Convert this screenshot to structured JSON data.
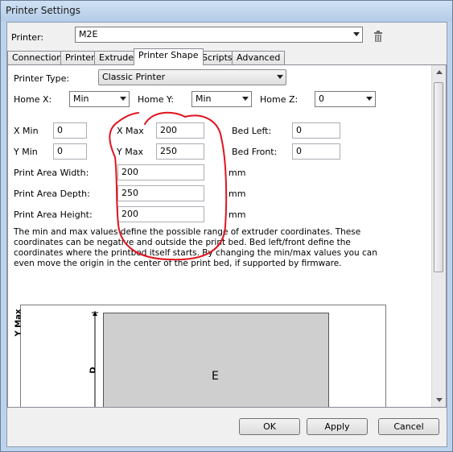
{
  "window": {
    "title": "Printer Settings"
  },
  "printer": {
    "label": "Printer:",
    "value": "M2E"
  },
  "tabs": [
    {
      "label": "Connection"
    },
    {
      "label": "Printer"
    },
    {
      "label": "Extruder"
    },
    {
      "label": "Printer Shape"
    },
    {
      "label": "Scripts"
    },
    {
      "label": "Advanced"
    }
  ],
  "active_tab": "Printer Shape",
  "shape": {
    "printer_type_label": "Printer Type:",
    "printer_type_value": "Classic Printer",
    "home_x_label": "Home X:",
    "home_x_value": "Min",
    "home_y_label": "Home Y:",
    "home_y_value": "Min",
    "home_z_label": "Home Z:",
    "home_z_value": "0",
    "x_min_label": "X Min",
    "x_min_value": "0",
    "y_min_label": "Y Min",
    "y_min_value": "0",
    "x_max_label": "X Max",
    "x_max_value": "200",
    "y_max_label": "Y Max",
    "y_max_value": "250",
    "bed_left_label": "Bed Left:",
    "bed_left_value": "0",
    "bed_front_label": "Bed Front:",
    "bed_front_value": "0",
    "area_width_label": "Print Area Width:",
    "area_width_value": "200",
    "area_depth_label": "Print Area Depth:",
    "area_depth_value": "250",
    "area_height_label": "Print Area Height:",
    "area_height_value": "200",
    "unit": "mm",
    "description": "The min and max values define the possible range of extruder coordinates. These coordinates can be negative and outside the print bed. Bed left/front define the coordinates where the printbed itself starts. By changing the min/max values you can even move the origin in the center of the print bed, if supported by firmware."
  },
  "diagram": {
    "y_axis_label": "Y Max",
    "depth_label": "D",
    "bed_label": "E"
  },
  "buttons": {
    "ok": "OK",
    "apply": "Apply",
    "cancel": "Cancel"
  },
  "colors": {
    "annotation": "#e0141e",
    "frame": "#bcd3ec"
  }
}
